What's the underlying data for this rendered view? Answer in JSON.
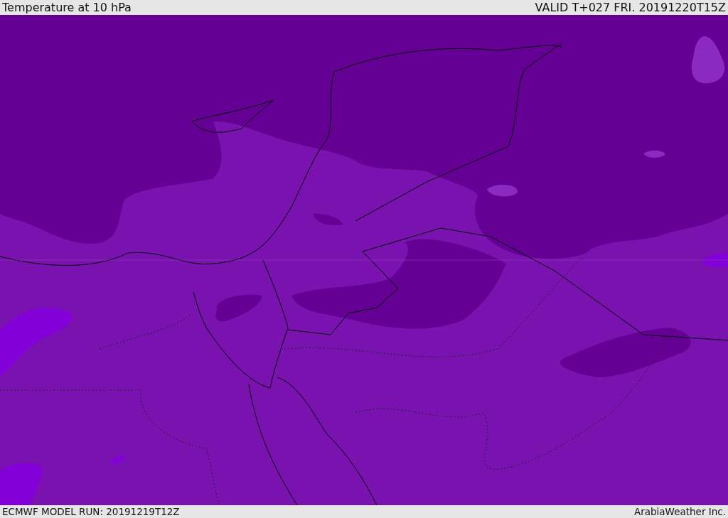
{
  "header": {
    "title": "Temperature at 10 hPa",
    "valid": "VALID T+027 FRI. 20191220T15Z"
  },
  "footer": {
    "model_run": "ECMWF MODEL RUN: 20191219T12Z",
    "credit": "ArabiaWeather Inc."
  }
}
